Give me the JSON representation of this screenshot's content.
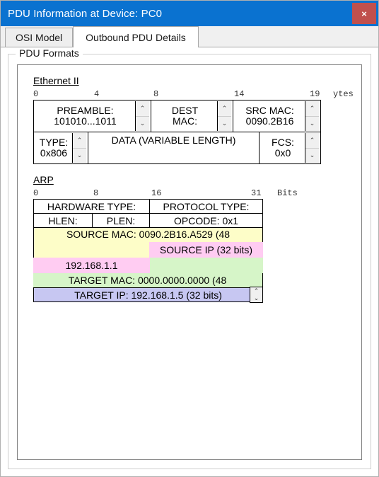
{
  "window": {
    "title": "PDU Information at Device: PC0",
    "close_label": "×",
    "titlebar_color": "#0a72d0",
    "close_color": "#c0504d"
  },
  "tabs": [
    {
      "label": "OSI Model",
      "active": false
    },
    {
      "label": "Outbound PDU Details",
      "active": true
    }
  ],
  "groupbox": {
    "legend": "PDU Formats"
  },
  "ethernet": {
    "title": "Ethernet II",
    "unit": "ytes",
    "ruler": [
      "0",
      "4",
      "8",
      "14",
      "19"
    ],
    "row1": [
      {
        "line1": "PREAMBLE:",
        "line2": "101010...1011",
        "spinner": true
      },
      {
        "line1": "DEST",
        "line2": "MAC:",
        "spinner": true
      },
      {
        "line1": "SRC MAC:",
        "line2": "0090.2B16",
        "spinner": true
      }
    ],
    "row2": [
      {
        "line1": "TYPE:",
        "line2": "0x806",
        "spinner": true
      },
      {
        "line1": "DATA (VARIABLE LENGTH)",
        "line2": "",
        "spinner": false
      },
      {
        "line1": "FCS:",
        "line2": "0x0",
        "spinner": true
      }
    ]
  },
  "arp": {
    "title": "ARP",
    "unit": "Bits",
    "ruler": [
      "0",
      "8",
      "16",
      "31"
    ],
    "hardware_type": "HARDWARE TYPE:",
    "protocol_type": "PROTOCOL TYPE:",
    "hlen": "HLEN:",
    "plen": "PLEN:",
    "opcode": "OPCODE: 0x1",
    "source_mac": "SOURCE MAC: 0090.2B16.A529 (48",
    "source_ip_label": "SOURCE IP (32 bits)",
    "source_ip_value": "192.168.1.1",
    "target_mac": "TARGET MAC: 0000.0000.0000 (48",
    "target_ip": "TARGET IP: 192.168.1.5 (32 bits)",
    "colors": {
      "source_mac": "#fdfdc8",
      "source_ip": "#ffccf2",
      "target_mac": "#d6f5c8",
      "target_ip": "#c7c7f2"
    }
  },
  "icons": {
    "spin_up": "⌃",
    "spin_down": "⌄"
  }
}
